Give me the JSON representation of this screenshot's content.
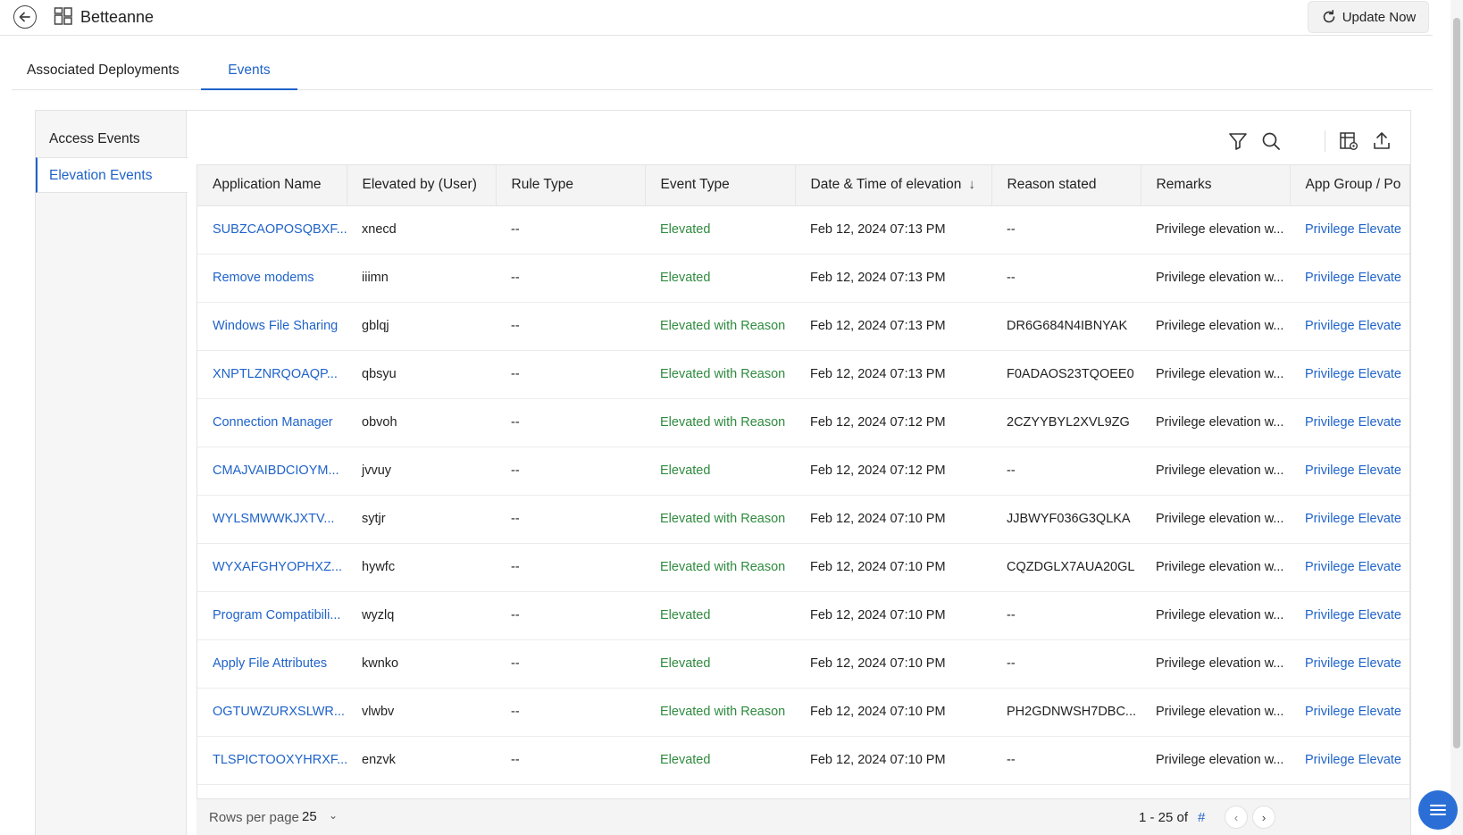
{
  "header": {
    "title": "Betteanne",
    "update_label": "Update Now",
    "back_icon": "arrow-left-circle-icon",
    "device_icon": "grid-device-icon",
    "refresh_icon": "refresh-icon"
  },
  "tabs": [
    {
      "label": "Associated Deployments",
      "active": false
    },
    {
      "label": "Events",
      "active": true
    }
  ],
  "sidenav": {
    "items": [
      {
        "label": "Access Events",
        "active": false
      },
      {
        "label": "Elevation Events",
        "active": true
      }
    ]
  },
  "toolbar": {
    "icons": [
      "filter-icon",
      "search-icon",
      "column-settings-icon",
      "export-icon"
    ]
  },
  "table": {
    "columns": [
      "Application Name",
      "Elevated by (User)",
      "Rule Type",
      "Event Type",
      "Date & Time of elevation",
      "Reason stated",
      "Remarks",
      "App Group / Po"
    ],
    "sorted_column": "Date & Time of elevation",
    "sort_direction": "descending",
    "rows": [
      [
        "SUBZCAOPOSQBXF...",
        "xnecd",
        "--",
        "Elevated",
        "Feb 12, 2024 07:13 PM",
        "--",
        "Privilege elevation w...",
        "Privilege Elevate"
      ],
      [
        "Remove modems",
        "iiimn",
        "--",
        "Elevated",
        "Feb 12, 2024 07:13 PM",
        "--",
        "Privilege elevation w...",
        "Privilege Elevate"
      ],
      [
        "Windows File Sharing",
        "gblqj",
        "--",
        "Elevated with Reason",
        "Feb 12, 2024 07:13 PM",
        "DR6G684N4IBNYAK",
        "Privilege elevation w...",
        "Privilege Elevate"
      ],
      [
        "XNPTLZNRQOAQP...",
        "qbsyu",
        "--",
        "Elevated with Reason",
        "Feb 12, 2024 07:13 PM",
        "F0ADAOS23TQOEE0",
        "Privilege elevation w...",
        "Privilege Elevate"
      ],
      [
        "Connection Manager",
        "obvoh",
        "--",
        "Elevated with Reason",
        "Feb 12, 2024 07:12 PM",
        "2CZYYBYL2XVL9ZG",
        "Privilege elevation w...",
        "Privilege Elevate"
      ],
      [
        "CMAJVAIBDCIOYM...",
        "jvvuy",
        "--",
        "Elevated",
        "Feb 12, 2024 07:12 PM",
        "--",
        "Privilege elevation w...",
        "Privilege Elevate"
      ],
      [
        "WYLSMWWKJXTV...",
        "sytjr",
        "--",
        "Elevated with Reason",
        "Feb 12, 2024 07:10 PM",
        "JJBWYF036G3QLKA",
        "Privilege elevation w...",
        "Privilege Elevate"
      ],
      [
        "WYXAFGHYOPHXZ...",
        "hywfc",
        "--",
        "Elevated with Reason",
        "Feb 12, 2024 07:10 PM",
        "CQZDGLX7AUA20GL",
        "Privilege elevation w...",
        "Privilege Elevate"
      ],
      [
        "Program Compatibili...",
        "wyzlq",
        "--",
        "Elevated",
        "Feb 12, 2024 07:10 PM",
        "--",
        "Privilege elevation w...",
        "Privilege Elevate"
      ],
      [
        "Apply File Attributes",
        "kwnko",
        "--",
        "Elevated",
        "Feb 12, 2024 07:10 PM",
        "--",
        "Privilege elevation w...",
        "Privilege Elevate"
      ],
      [
        "OGTUWZURXSLWR...",
        "vlwbv",
        "--",
        "Elevated with Reason",
        "Feb 12, 2024 07:10 PM",
        "PH2GDNWSH7DBC...",
        "Privilege elevation w...",
        "Privilege Elevate"
      ],
      [
        "TLSPICTOOXYHRXF...",
        "enzvk",
        "--",
        "Elevated",
        "Feb 12, 2024 07:10 PM",
        "--",
        "Privilege elevation w...",
        "Privilege Elevate"
      ]
    ]
  },
  "pager": {
    "rows_label": "Rows per page",
    "rows_value": "25",
    "range": "1 - 25 of",
    "total": "#"
  },
  "colors": {
    "accent": "#1f63c9",
    "event_green": "#2e8b3e",
    "fab": "#2b6fd6"
  }
}
